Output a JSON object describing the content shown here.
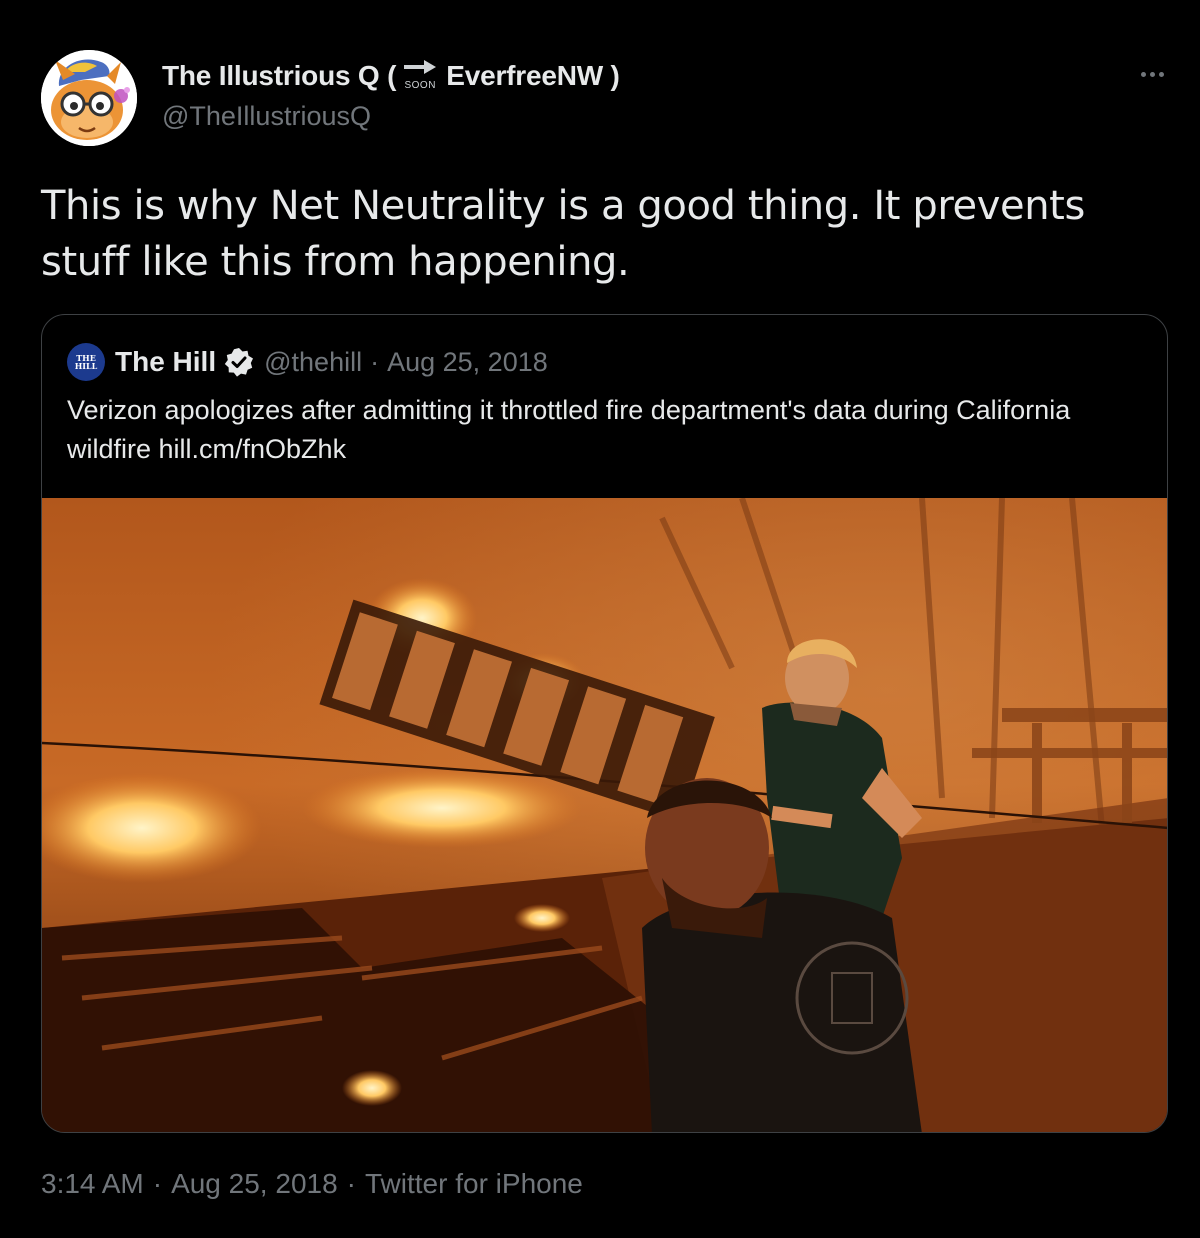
{
  "tweet": {
    "author": {
      "name_part1": "The Illustrious Q (",
      "soon_label": "SOON",
      "name_part2": "EverfreeNW )",
      "handle": "@TheIllustriousQ",
      "avatar_icon": "pony-avatar-icon"
    },
    "more_icon": "more-dots-icon",
    "text": "This is why Net Neutrality is a good thing. It prevents\nstuff like this from happening.",
    "quoted": {
      "logo_text_top": "THE",
      "logo_text_bottom": "HILL",
      "name": "The Hill",
      "verified_icon": "verified-badge-icon",
      "handle": "@thehill",
      "separator": "·",
      "date": "Aug 25, 2018",
      "text": "Verizon apologizes after admitting it throttled fire department's data during California wildfire hill.cm/fnObZhk",
      "image_icon": "wildfire-photo"
    },
    "footer": {
      "time": "3:14 AM",
      "separator": "·",
      "date": "Aug 25, 2018",
      "source": "Twitter for iPhone"
    }
  },
  "colors": {
    "background": "#000000",
    "primary_text": "#e7e9ea",
    "secondary_text": "#71767b",
    "border": "#3e4144",
    "hill_blue": "#1c3a8e"
  }
}
